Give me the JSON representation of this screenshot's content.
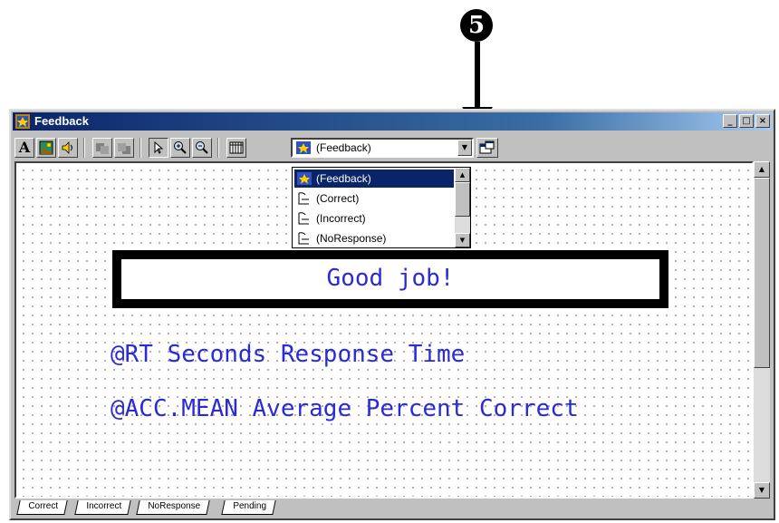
{
  "callout": {
    "number": "5"
  },
  "window": {
    "title": "Feedback",
    "title_buttons": {
      "minimize": "_",
      "maximize": "□",
      "close": "×"
    }
  },
  "toolbar": {
    "text_tool": "A",
    "object_selector": {
      "selected": "(Feedback)",
      "options": [
        "(Feedback)",
        "(Correct)",
        "(Incorrect)",
        "(NoResponse)"
      ]
    }
  },
  "canvas": {
    "feedback_text": "Good job!",
    "line1": "@RT Seconds Response Time",
    "line2": "@ACC.MEAN Average Percent Correct"
  },
  "tabs": [
    "Correct",
    "Incorrect",
    "NoResponse",
    "Pending"
  ],
  "colors": {
    "title_bar": "#0a246a",
    "canvas_text": "#2a2ad8",
    "selection": "#0a246a"
  }
}
